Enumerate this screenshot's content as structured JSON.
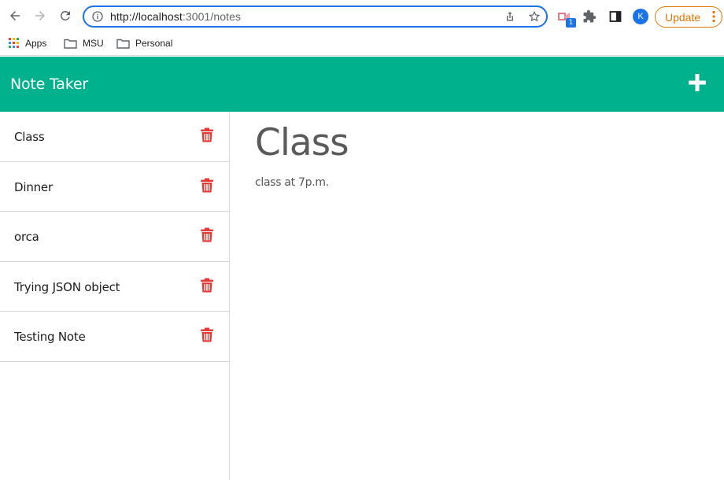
{
  "browser": {
    "url_host": "http://localhost",
    "url_rest": ":3001/notes",
    "extension_badge": "1",
    "profile_initial": "K",
    "update_label": "Update",
    "bookmarks": [
      {
        "label": "Apps",
        "icon": "apps-grid-icon"
      },
      {
        "label": "MSU",
        "icon": "folder-icon"
      },
      {
        "label": "Personal",
        "icon": "folder-icon"
      }
    ]
  },
  "app": {
    "title": "Note Taker",
    "accent": "#00b18d",
    "delete_color": "#e53935"
  },
  "notes": [
    {
      "title": "Class"
    },
    {
      "title": "Dinner"
    },
    {
      "title": "orca"
    },
    {
      "title": "Trying JSON object"
    },
    {
      "title": "Testing Note"
    }
  ],
  "active_note": {
    "title": "Class",
    "text": "class at 7p.m."
  }
}
